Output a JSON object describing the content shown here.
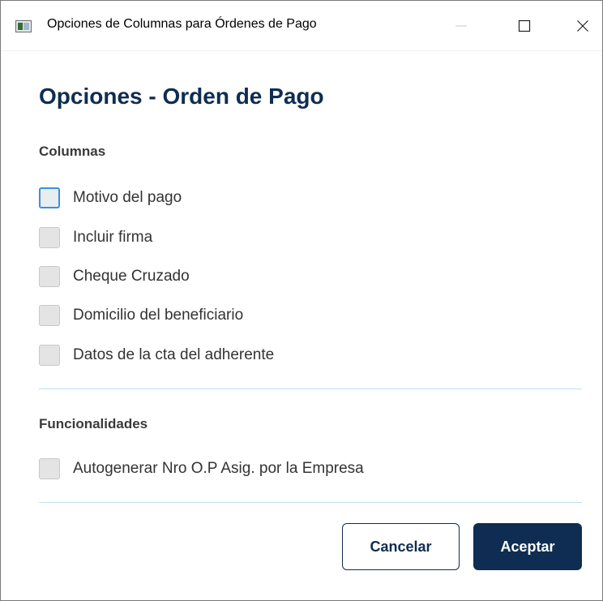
{
  "window": {
    "title": "Opciones de Columnas para Órdenes de Pago"
  },
  "dialog": {
    "heading": "Opciones - Orden de Pago",
    "columns_section": {
      "label": "Columnas",
      "options": [
        {
          "label": "Motivo del pago",
          "checked": false,
          "focused": true
        },
        {
          "label": "Incluir firma",
          "checked": false
        },
        {
          "label": "Cheque Cruzado",
          "checked": false
        },
        {
          "label": "Domicilio del beneficiario",
          "checked": false
        },
        {
          "label": "Datos de la cta del adherente",
          "checked": false
        }
      ]
    },
    "features_section": {
      "label": "Funcionalidades",
      "options": [
        {
          "label": "Autogenerar Nro O.P Asig. por la Empresa",
          "checked": false
        }
      ]
    },
    "buttons": {
      "cancel": "Cancelar",
      "accept": "Aceptar"
    }
  },
  "colors": {
    "primary": "#0f2d52",
    "focus_ring": "#3d8fd6",
    "divider": "#bfe0f2"
  },
  "icons": {
    "app": "app-window-icon",
    "minimize": "minimize-icon",
    "maximize": "maximize-icon",
    "close": "close-icon"
  }
}
